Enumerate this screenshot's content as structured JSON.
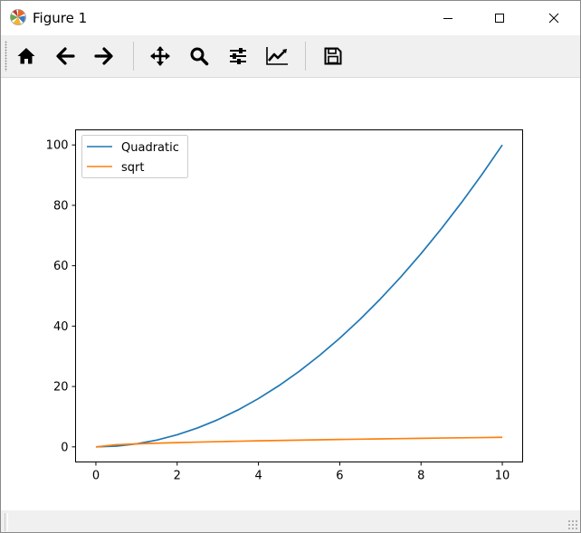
{
  "window": {
    "title": "Figure 1",
    "controls": {
      "minimize": "minimize",
      "maximize": "maximize",
      "close": "close"
    }
  },
  "toolbar": {
    "buttons": [
      {
        "name": "home",
        "icon": "home-icon"
      },
      {
        "name": "back",
        "icon": "arrow-left-icon"
      },
      {
        "name": "forward",
        "icon": "arrow-right-icon"
      },
      {
        "name": "pan",
        "icon": "move-icon"
      },
      {
        "name": "zoom",
        "icon": "magnifier-icon"
      },
      {
        "name": "subplots",
        "icon": "sliders-icon"
      },
      {
        "name": "customize",
        "icon": "line-chart-icon"
      },
      {
        "name": "save",
        "icon": "floppy-disk-icon"
      }
    ]
  },
  "colors": {
    "series_quadratic": "#1f77b4",
    "series_sqrt": "#ff7f0e",
    "toolbar_bg": "#f0f0f0"
  },
  "chart_data": {
    "type": "line",
    "title": "",
    "xlabel": "",
    "ylabel": "",
    "xlim": [
      -0.5,
      10.5
    ],
    "ylim": [
      -5,
      105
    ],
    "xticks": [
      0,
      2,
      4,
      6,
      8,
      10
    ],
    "yticks": [
      0,
      20,
      40,
      60,
      80,
      100
    ],
    "xtick_labels": [
      "0",
      "2",
      "4",
      "6",
      "8",
      "10"
    ],
    "ytick_labels": [
      "0",
      "20",
      "40",
      "60",
      "80",
      "100"
    ],
    "grid": false,
    "legend_position": "top-left",
    "x": [
      0,
      0.5,
      1,
      1.5,
      2,
      2.5,
      3,
      3.5,
      4,
      4.5,
      5,
      5.5,
      6,
      6.5,
      7,
      7.5,
      8,
      8.5,
      9,
      9.5,
      10
    ],
    "series": [
      {
        "name": "Quadratic",
        "color": "#1f77b4",
        "values": [
          0,
          0.25,
          1,
          2.25,
          4,
          6.25,
          9,
          12.25,
          16,
          20.25,
          25,
          30.25,
          36,
          42.25,
          49,
          56.25,
          64,
          72.25,
          81,
          90.25,
          100
        ]
      },
      {
        "name": "sqrt",
        "color": "#ff7f0e",
        "values": [
          0,
          0.71,
          1,
          1.22,
          1.41,
          1.58,
          1.73,
          1.87,
          2,
          2.12,
          2.24,
          2.35,
          2.45,
          2.55,
          2.65,
          2.74,
          2.83,
          2.92,
          3,
          3.08,
          3.16
        ]
      }
    ]
  }
}
